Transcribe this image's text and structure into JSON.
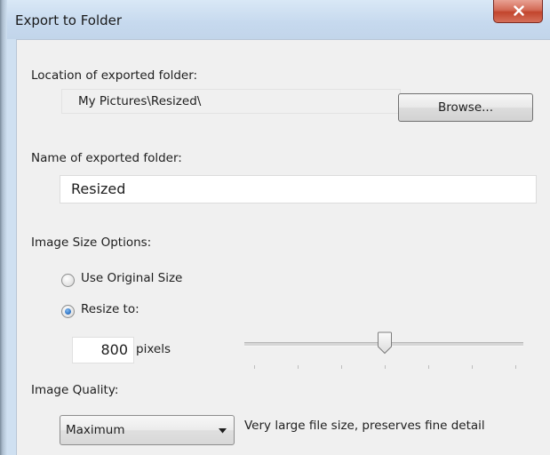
{
  "window": {
    "title": "Export to Folder"
  },
  "location": {
    "label": "Location of exported folder:",
    "path": "My Pictures\\Resized\\",
    "browse_label": "Browse..."
  },
  "name": {
    "label": "Name of exported folder:",
    "value": "Resized"
  },
  "size_options": {
    "label": "Image Size Options:",
    "original_label": "Use Original Size",
    "resize_label": "Resize to:",
    "selected": "resize",
    "pixels_value": "800",
    "pixels_unit": "pixels",
    "slider_level": 0.52
  },
  "quality": {
    "label": "Image Quality:",
    "selected": "Maximum",
    "description": "Very large file size, preserves fine detail"
  },
  "icons": {
    "close": "close-icon",
    "dropdown": "chevron-down-icon"
  },
  "colors": {
    "close_button": "#c2452d",
    "radio_selected": "#2a6fc0"
  }
}
